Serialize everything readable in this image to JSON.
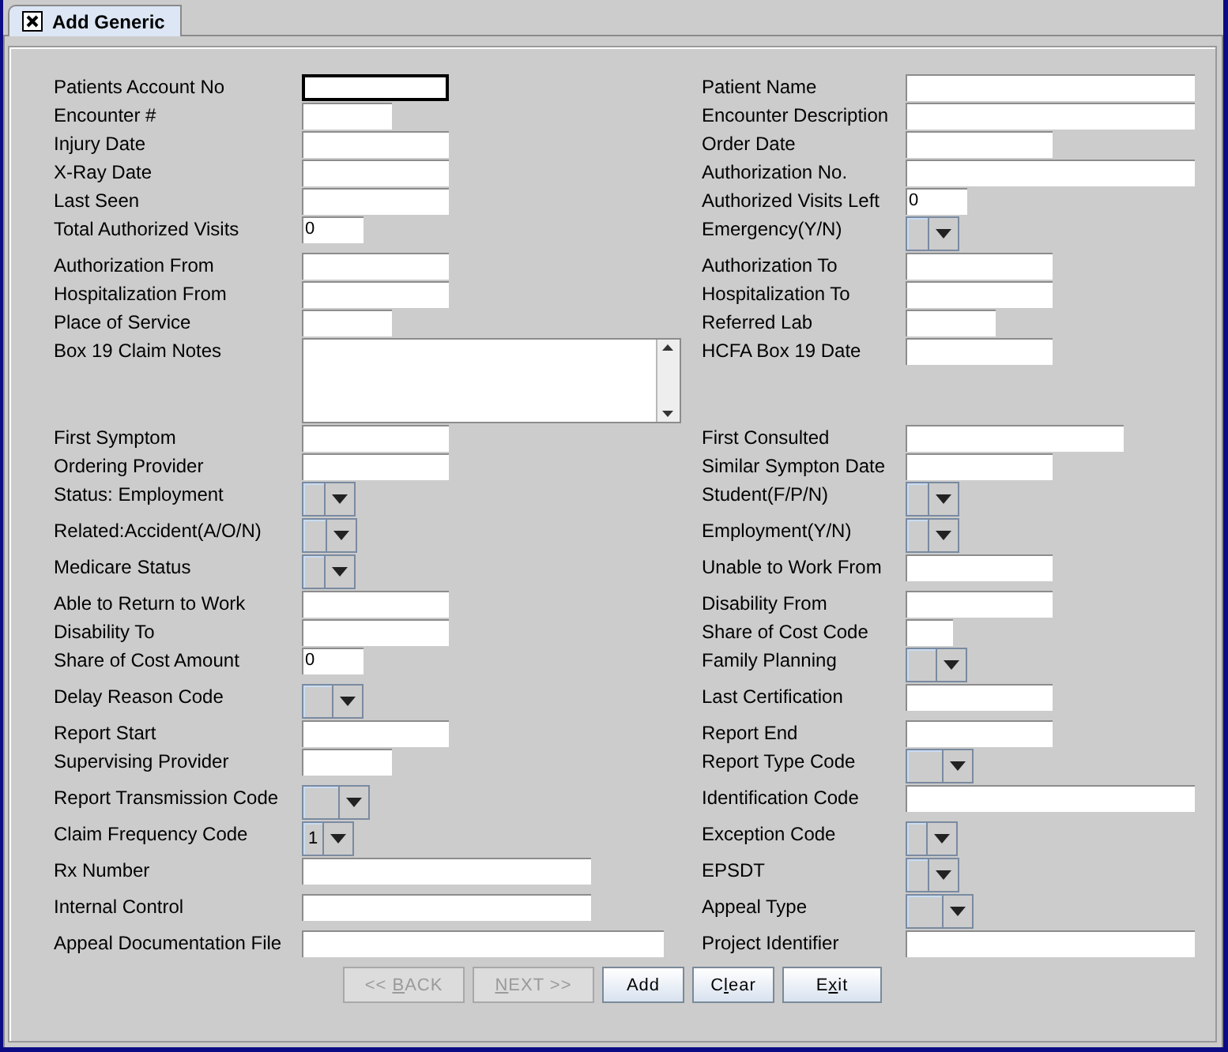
{
  "tab": {
    "label": "Add Generic",
    "selected": true
  },
  "rows": [
    {
      "left": {
        "label": "Patients Account No",
        "kind": "text",
        "focused": true
      },
      "right": {
        "label": "Patient Name",
        "kind": "text",
        "focused": false
      }
    },
    {
      "left": {
        "label": "Encounter #",
        "kind": "text",
        "focused": false
      },
      "right": {
        "label": "Encounter Description",
        "kind": "text",
        "focused": false
      }
    },
    {
      "left": {
        "label": "Injury Date",
        "kind": "text",
        "focused": false
      },
      "right": {
        "label": "Order Date",
        "kind": "text",
        "focused": false
      }
    },
    {
      "left": {
        "label": "X-Ray Date",
        "kind": "text",
        "focused": false
      },
      "right": {
        "label": "Authorization No.",
        "kind": "text",
        "focused": false
      }
    },
    {
      "left": {
        "label": "Last Seen",
        "kind": "text",
        "focused": false
      },
      "right": {
        "label": "Authorized Visits Left",
        "kind": "text",
        "value": "0",
        "focused": false
      }
    },
    {
      "left": {
        "label": "Total Authorized Visits",
        "kind": "text",
        "value": "0",
        "focused": false
      },
      "right": {
        "label": "Emergency(Y/N)",
        "kind": "combo"
      }
    },
    {
      "left": {
        "label": "Authorization From",
        "kind": "text",
        "focused": false
      },
      "right": {
        "label": "Authorization To",
        "kind": "text",
        "focused": false
      }
    },
    {
      "left": {
        "label": "Hospitalization From",
        "kind": "text",
        "focused": false
      },
      "right": {
        "label": "Hospitalization To",
        "kind": "text",
        "focused": false
      }
    },
    {
      "left": {
        "label": "Place of Service",
        "kind": "text",
        "focused": false
      },
      "right": {
        "label": "Referred Lab",
        "kind": "text",
        "focused": false
      }
    },
    {
      "left": {
        "label": "Box 19 Claim Notes",
        "kind": "textarea"
      },
      "right": {
        "label": "HCFA Box 19 Date",
        "kind": "text",
        "focused": false
      }
    },
    {
      "left": {
        "label": "First Symptom",
        "kind": "text",
        "focused": false
      },
      "right": {
        "label": "First Consulted",
        "kind": "text",
        "focused": false
      }
    },
    {
      "left": {
        "label": "Ordering Provider",
        "kind": "text",
        "focused": false
      },
      "right": {
        "label": "Similar Sympton Date",
        "kind": "text",
        "focused": false
      }
    },
    {
      "left": {
        "label": "Status: Employment",
        "kind": "combo"
      },
      "right": {
        "label": "Student(F/P/N)",
        "kind": "combo"
      }
    },
    {
      "left": {
        "label": "Related:Accident(A/O/N)",
        "kind": "combo"
      },
      "right": {
        "label": "Employment(Y/N)",
        "kind": "combo"
      }
    },
    {
      "left": {
        "label": "Medicare Status",
        "kind": "combo"
      },
      "right": {
        "label": "Unable to Work From",
        "kind": "text",
        "focused": false
      }
    },
    {
      "left": {
        "label": "Able to Return to Work",
        "kind": "text",
        "focused": false
      },
      "right": {
        "label": "Disability From",
        "kind": "text",
        "focused": false
      }
    },
    {
      "left": {
        "label": "Disability To",
        "kind": "text",
        "focused": false
      },
      "right": {
        "label": "Share of Cost Code",
        "kind": "text",
        "focused": false
      }
    },
    {
      "left": {
        "label": "Share of Cost Amount",
        "kind": "text",
        "value": "0",
        "focused": false
      },
      "right": {
        "label": "Family Planning",
        "kind": "combo"
      }
    },
    {
      "left": {
        "label": "Delay Reason Code",
        "kind": "combo"
      },
      "right": {
        "label": "Last Certification",
        "kind": "text",
        "focused": false
      }
    },
    {
      "left": {
        "label": "Report Start",
        "kind": "text",
        "focused": false
      },
      "right": {
        "label": "Report End",
        "kind": "text",
        "focused": false
      }
    },
    {
      "left": {
        "label": "Supervising Provider",
        "kind": "text",
        "focused": false
      },
      "right": {
        "label": "Report Type Code",
        "kind": "combo"
      }
    },
    {
      "left": {
        "label": "Report Transmission Code",
        "kind": "combo"
      },
      "right": {
        "label": "Identification Code",
        "kind": "text",
        "focused": false
      }
    },
    {
      "left": {
        "label": "Claim Frequency Code",
        "kind": "combo",
        "value": "1"
      },
      "right": {
        "label": "Exception Code",
        "kind": "combo"
      }
    },
    {
      "left": {
        "label": "Rx Number",
        "kind": "text",
        "focused": false
      },
      "right": {
        "label": "EPSDT",
        "kind": "combo"
      }
    },
    {
      "left": {
        "label": "Internal Control",
        "kind": "text",
        "focused": false
      },
      "right": {
        "label": "Appeal Type",
        "kind": "combo"
      }
    },
    {
      "left": {
        "label": "Appeal Documentation File",
        "kind": "text",
        "focused": false
      },
      "right": {
        "label": "Project Identifier",
        "kind": "text",
        "focused": false
      }
    }
  ],
  "buttons": [
    {
      "parts": [
        {
          "text": "<< ",
          "underlined": false
        },
        {
          "text": "B",
          "underlined": true
        },
        {
          "text": "ACK",
          "underlined": false
        }
      ],
      "disabled": true
    },
    {
      "parts": [
        {
          "text": "N",
          "underlined": true
        },
        {
          "text": "EXT >>",
          "underlined": false
        }
      ],
      "disabled": true
    },
    {
      "parts": [
        {
          "text": "Add",
          "underlined": false
        }
      ],
      "disabled": false
    },
    {
      "parts": [
        {
          "text": "C",
          "underlined": false
        },
        {
          "text": "l",
          "underlined": true
        },
        {
          "text": "ear",
          "underlined": false
        }
      ],
      "disabled": false
    },
    {
      "parts": [
        {
          "text": "E",
          "underlined": false
        },
        {
          "text": "x",
          "underlined": true
        },
        {
          "text": "it",
          "underlined": false
        }
      ],
      "disabled": false
    }
  ]
}
